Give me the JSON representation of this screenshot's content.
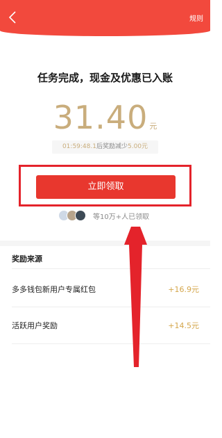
{
  "header": {
    "rules_label": "规则"
  },
  "main": {
    "title": "任务完成，现金及优惠已入账",
    "amount": "31.40",
    "amount_unit": "元",
    "countdown_time": "01:59:48.1",
    "countdown_text": "后奖励减少",
    "countdown_amount": "5.00元",
    "claim_button_label": "立即领取",
    "claimed_text": "等10万+人已领取"
  },
  "rewards": {
    "section_title": "奖励来源",
    "items": [
      {
        "label": "多多钱包新用户专属红包",
        "value": "+16.9元"
      },
      {
        "label": "活跃用户奖励",
        "value": "+14.5元"
      }
    ]
  },
  "colors": {
    "header": "#f2493d",
    "button": "#e8372e",
    "gold": "#c9ad7c",
    "annotation": "#e4232b"
  }
}
